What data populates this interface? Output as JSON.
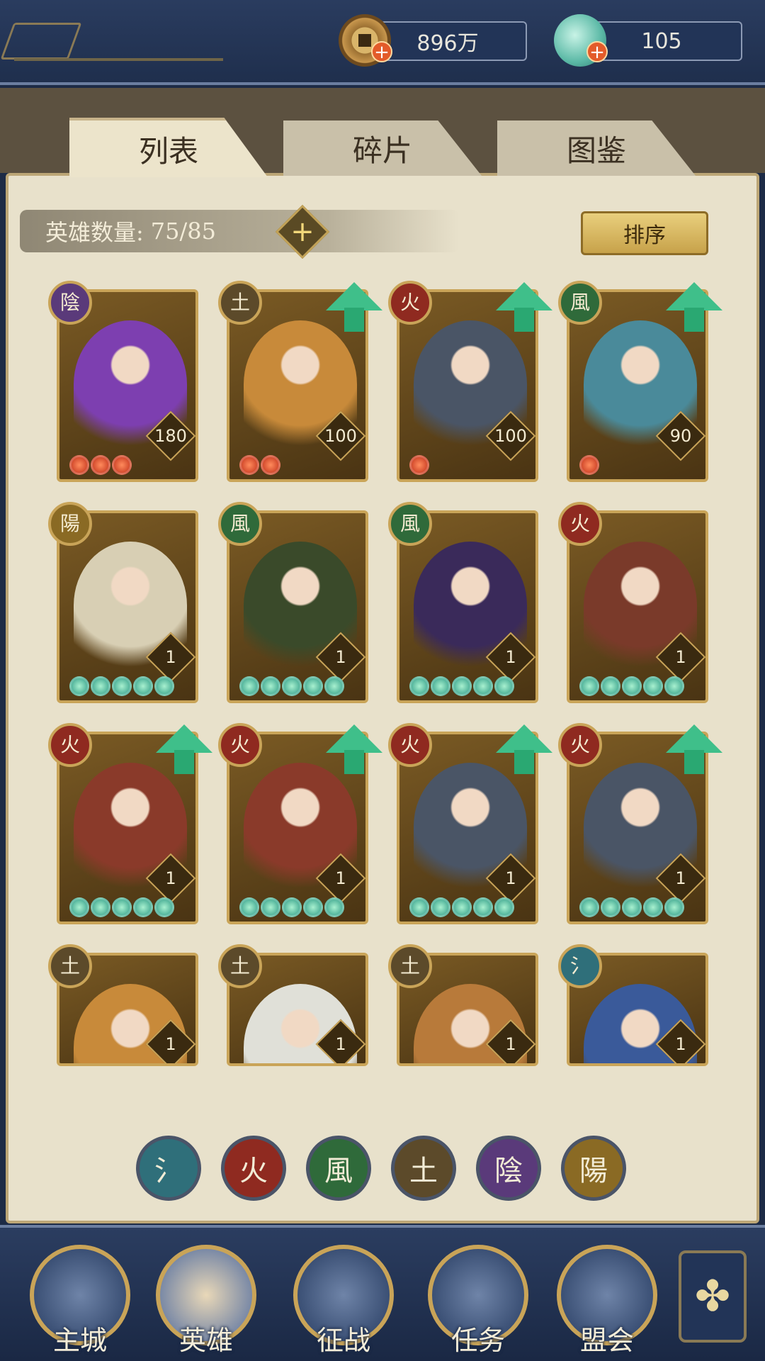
{
  "resources": {
    "coins": "896万",
    "shells": "105"
  },
  "tabs": [
    "列表",
    "碎片",
    "图鉴"
  ],
  "hero_count": {
    "label": "英雄数量:",
    "value": "75/85"
  },
  "sort_label": "排序",
  "element_glyphs": {
    "water": "氵",
    "fire": "火",
    "wind": "風",
    "earth": "土",
    "yin": "陰",
    "yang": "陽"
  },
  "colors": {
    "water": "#2f6f7a",
    "fire": "#8f2a20",
    "wind": "#2f6a3a",
    "earth": "#5c4a2a",
    "yin": "#5a3a7a",
    "yang": "#8a6a24"
  },
  "heroes": [
    {
      "element": "陰",
      "level": "180",
      "stars": 3,
      "star_color": "red",
      "upgrade": false,
      "portrait": "#7d3fb0"
    },
    {
      "element": "土",
      "level": "100",
      "stars": 2,
      "star_color": "red",
      "upgrade": true,
      "portrait": "#c88a3a"
    },
    {
      "element": "火",
      "level": "100",
      "stars": 1,
      "star_color": "red",
      "upgrade": true,
      "portrait": "#4a5566"
    },
    {
      "element": "風",
      "level": "90",
      "stars": 1,
      "star_color": "red",
      "upgrade": true,
      "portrait": "#4a8a9a"
    },
    {
      "element": "陽",
      "level": "1",
      "stars": 5,
      "star_color": "green",
      "upgrade": false,
      "portrait": "#d8cfb4"
    },
    {
      "element": "風",
      "level": "1",
      "stars": 5,
      "star_color": "green",
      "upgrade": false,
      "portrait": "#3a4a2a"
    },
    {
      "element": "風",
      "level": "1",
      "stars": 5,
      "star_color": "green",
      "upgrade": false,
      "portrait": "#3a2a5a"
    },
    {
      "element": "火",
      "level": "1",
      "stars": 5,
      "star_color": "green",
      "upgrade": false,
      "portrait": "#7a3a2a"
    },
    {
      "element": "火",
      "level": "1",
      "stars": 5,
      "star_color": "green",
      "upgrade": true,
      "portrait": "#8a3a2a"
    },
    {
      "element": "火",
      "level": "1",
      "stars": 5,
      "star_color": "green",
      "upgrade": true,
      "portrait": "#8a3a2a"
    },
    {
      "element": "火",
      "level": "1",
      "stars": 5,
      "star_color": "green",
      "upgrade": true,
      "portrait": "#4a5566"
    },
    {
      "element": "火",
      "level": "1",
      "stars": 5,
      "star_color": "green",
      "upgrade": true,
      "portrait": "#4a5566"
    },
    {
      "element": "土",
      "level": "1",
      "stars": 0,
      "star_color": "green",
      "upgrade": false,
      "portrait": "#c88a3a"
    },
    {
      "element": "土",
      "level": "1",
      "stars": 0,
      "star_color": "green",
      "upgrade": false,
      "portrait": "#e0e0d8"
    },
    {
      "element": "土",
      "level": "1",
      "stars": 0,
      "star_color": "green",
      "upgrade": false,
      "portrait": "#b87a3a"
    },
    {
      "element": "氵",
      "level": "1",
      "stars": 0,
      "star_color": "green",
      "upgrade": false,
      "portrait": "#3a5a9a"
    }
  ],
  "filters": [
    "氵",
    "火",
    "風",
    "土",
    "陰",
    "陽"
  ],
  "nav": [
    "主城",
    "英雄",
    "征战",
    "任务",
    "盟会"
  ],
  "menu_icon": "clover-menu-icon"
}
